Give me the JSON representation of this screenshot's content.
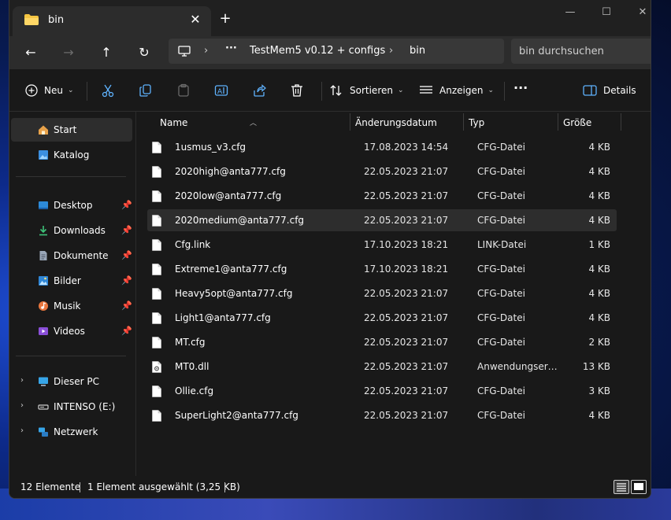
{
  "tab": {
    "title": "bin",
    "close": "✕",
    "new": "+"
  },
  "window_controls": {
    "minimize": "—",
    "maximize": "☐",
    "close": "✕"
  },
  "nav": {
    "back": "←",
    "forward": "→",
    "up": "↑",
    "refresh": "↻",
    "breadcrumb": [
      "TestMem5 v0.12 + configs",
      "bin"
    ],
    "more": "···",
    "sep": "›"
  },
  "search": {
    "placeholder": "bin durchsuchen"
  },
  "toolbar": {
    "new_label": "Neu",
    "sort_label": "Sortieren",
    "view_label": "Anzeigen",
    "more_label": "···",
    "details_label": "Details"
  },
  "sidebar": {
    "start": "Start",
    "katalog": "Katalog",
    "pinned": [
      {
        "label": "Desktop",
        "icon": "desktop-icon"
      },
      {
        "label": "Downloads",
        "icon": "download-icon"
      },
      {
        "label": "Dokumente",
        "icon": "document-icon"
      },
      {
        "label": "Bilder",
        "icon": "pictures-icon"
      },
      {
        "label": "Musik",
        "icon": "music-icon"
      },
      {
        "label": "Videos",
        "icon": "video-icon"
      }
    ],
    "devices": [
      {
        "label": "Dieser PC"
      },
      {
        "label": "INTENSO (E:)"
      },
      {
        "label": "Netzwerk"
      }
    ]
  },
  "columns": {
    "name": "Name",
    "date": "Änderungsdatum",
    "type": "Typ",
    "size": "Größe"
  },
  "files": [
    {
      "name": "1usmus_v3.cfg",
      "date": "17.08.2023 14:54",
      "type": "CFG-Datei",
      "size": "4 KB"
    },
    {
      "name": "2020high@anta777.cfg",
      "date": "22.05.2023 21:07",
      "type": "CFG-Datei",
      "size": "4 KB"
    },
    {
      "name": "2020low@anta777.cfg",
      "date": "22.05.2023 21:07",
      "type": "CFG-Datei",
      "size": "4 KB"
    },
    {
      "name": "2020medium@anta777.cfg",
      "date": "22.05.2023 21:07",
      "type": "CFG-Datei",
      "size": "4 KB",
      "selected": true
    },
    {
      "name": "Cfg.link",
      "date": "17.10.2023 18:21",
      "type": "LINK-Datei",
      "size": "1 KB"
    },
    {
      "name": "Extreme1@anta777.cfg",
      "date": "17.10.2023 18:21",
      "type": "CFG-Datei",
      "size": "4 KB"
    },
    {
      "name": "Heavy5opt@anta777.cfg",
      "date": "22.05.2023 21:07",
      "type": "CFG-Datei",
      "size": "4 KB"
    },
    {
      "name": "Light1@anta777.cfg",
      "date": "22.05.2023 21:07",
      "type": "CFG-Datei",
      "size": "4 KB"
    },
    {
      "name": "MT.cfg",
      "date": "22.05.2023 21:07",
      "type": "CFG-Datei",
      "size": "2 KB"
    },
    {
      "name": "MT0.dll",
      "date": "22.05.2023 21:07",
      "type": "Anwendungserwe...",
      "size": "13 KB",
      "dll": true
    },
    {
      "name": "Ollie.cfg",
      "date": "22.05.2023 21:07",
      "type": "CFG-Datei",
      "size": "3 KB"
    },
    {
      "name": "SuperLight2@anta777.cfg",
      "date": "22.05.2023 21:07",
      "type": "CFG-Datei",
      "size": "4 KB"
    }
  ],
  "status": {
    "count": "12 Elemente",
    "selection": "1 Element ausgewählt (3,25 KB)"
  },
  "colors": {
    "window_bg": "#191919",
    "bar_bg": "#2c2c2c",
    "accent_folder": "#f5c542"
  }
}
